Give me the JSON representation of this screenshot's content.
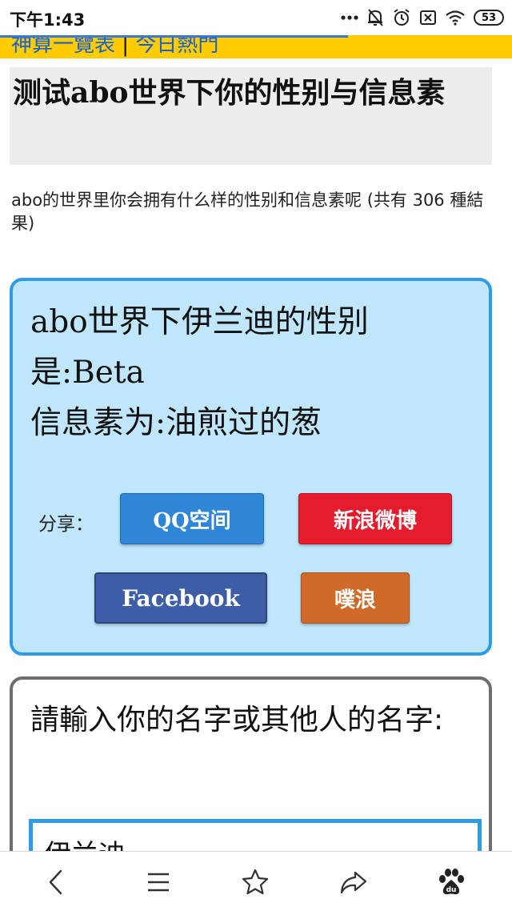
{
  "status_bar": {
    "time": "下午1:43",
    "battery": "53",
    "icons": [
      "more-dots-icon",
      "bell-off-icon",
      "alarm-icon",
      "sim-off-icon",
      "wifi-icon",
      "battery-icon"
    ]
  },
  "page_load_progress": 0.68,
  "nav": {
    "link1": "神算一覽表",
    "separator": "|",
    "link2": "今日熱門"
  },
  "title": "测试abo世界下你的性别与信息素",
  "description": "abo的世界里你会拥有什么样的性别和信息素呢 (共有 306 種結果)",
  "result": {
    "line1": "abo世界下伊兰迪的性别是:Beta",
    "line2": "信息素为:油煎过的葱"
  },
  "share": {
    "label": "分享：",
    "qq": "QQ空间",
    "weibo": "新浪微博",
    "facebook": "Facebook",
    "plurk": "噗浪"
  },
  "name_form": {
    "label": "請輸入你的名字或其他人的名字:",
    "value": "伊兰迪"
  },
  "bottom_bar": {
    "icons": [
      "back-icon",
      "menu-icon",
      "star-icon",
      "share-icon",
      "baidu-icon"
    ]
  },
  "colors": {
    "nav_bar": "#ffcc00",
    "link": "#1a5fd0",
    "result_card_bg": "#bfe6fa",
    "result_card_border": "#2e9be8",
    "qq": "#2f86d6",
    "weibo": "#e51c2e",
    "facebook": "#3d5ea6",
    "plurk": "#cf6a28"
  }
}
